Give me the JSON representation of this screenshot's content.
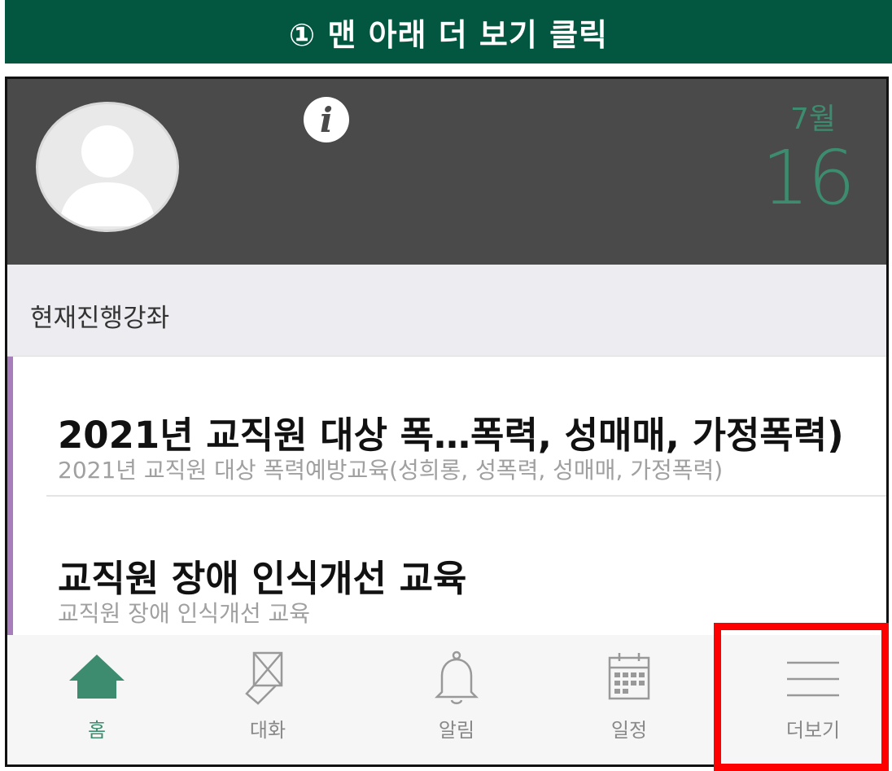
{
  "banner": {
    "text": "① 맨 아래 더 보기 클릭"
  },
  "header": {
    "info_glyph": "i",
    "month": "7월",
    "day": "16"
  },
  "section": {
    "title": "현재진행강좌"
  },
  "courses": [
    {
      "title": "2021년 교직원 대상 폭…폭력, 성매매, 가정폭력)",
      "subtitle": "2021년 교직원 대상 폭력예방교육(성희롱, 성폭력, 성매매, 가정폭력)"
    },
    {
      "title": "교직원 장애 인식개선 교육",
      "subtitle": "교직원 장애 인식개선 교육"
    }
  ],
  "tabs": [
    {
      "label": "홈",
      "icon": "home-icon",
      "active": true
    },
    {
      "label": "대화",
      "icon": "envelope-icon",
      "active": false
    },
    {
      "label": "알림",
      "icon": "bell-icon",
      "active": false
    },
    {
      "label": "일정",
      "icon": "calendar-icon",
      "active": false
    },
    {
      "label": "더보기",
      "icon": "menu-icon",
      "active": false
    }
  ],
  "colors": {
    "banner_bg": "#03563f",
    "accent_green": "#3e8c6f",
    "list_accent": "#a77dbb",
    "highlight": "#ff0000"
  }
}
